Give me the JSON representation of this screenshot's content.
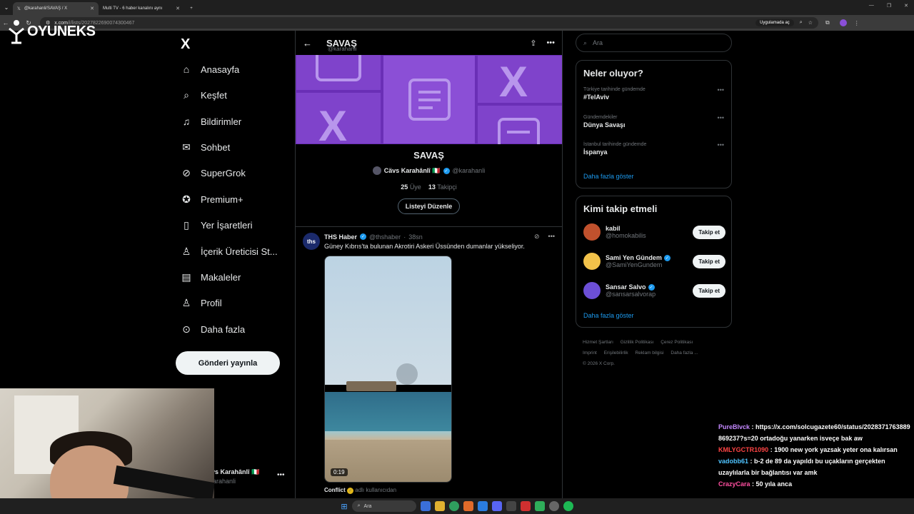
{
  "browser": {
    "tabs": [
      {
        "label": "@karahanli/SAVAŞ / X",
        "active": true
      },
      {
        "label": "Multi TV - 6 haber kanalını aynı",
        "active": false
      }
    ],
    "url_host": "x.com",
    "url_path": "/i/lists/2027822690074300467",
    "open_in_app": "Uygulamada aç"
  },
  "overlay_logo": "OYUNEKS",
  "sidebar": {
    "logo": "X",
    "items": [
      {
        "label": "Anasayfa",
        "icon": "home-icon",
        "glyph": "⌂"
      },
      {
        "label": "Keşfet",
        "icon": "search-icon",
        "glyph": "⌕"
      },
      {
        "label": "Bildirimler",
        "icon": "bell-icon",
        "glyph": "♫"
      },
      {
        "label": "Sohbet",
        "icon": "mail-icon",
        "glyph": "✉"
      },
      {
        "label": "SuperGrok",
        "icon": "grok-icon",
        "glyph": "⊘"
      },
      {
        "label": "Premium+",
        "icon": "premium-icon",
        "glyph": "✪"
      },
      {
        "label": "Yer İşaretleri",
        "icon": "bookmark-icon",
        "glyph": "▯"
      },
      {
        "label": "İçerik Üreticisi St...",
        "icon": "creator-icon",
        "glyph": "♙"
      },
      {
        "label": "Makaleler",
        "icon": "articles-icon",
        "glyph": "▤"
      },
      {
        "label": "Profil",
        "icon": "profile-icon",
        "glyph": "♙"
      },
      {
        "label": "Daha fazla",
        "icon": "more-icon",
        "glyph": "⊙"
      }
    ],
    "post_button": "Gönderi yayınla",
    "account_name": "vs Karahânlî 🇮🇹",
    "account_handle": "arahanli"
  },
  "main": {
    "header_title": "SAVAŞ",
    "header_handle": "@karahanli",
    "list_title": "SAVAŞ",
    "owner_name": "Cävs Karahânlî 🇮🇹",
    "owner_handle": "@karahanli",
    "members_count": "25",
    "members_label": "Üye",
    "followers_count": "13",
    "followers_label": "Takipçi",
    "edit_button": "Listeyi Düzenle",
    "tweet": {
      "avatar_text": "ths",
      "name": "THS Haber",
      "handle": "@thshaber",
      "time": "38sn",
      "text": "Güney Kıbrıs'ta bulunan Akrotiri Askeri Üssünden dumanlar yükseliyor.",
      "video_duration": "0:19",
      "footnote_name": "Conflict",
      "footnote_text": "adlı kullanıcıdan"
    }
  },
  "right": {
    "search_placeholder": "Ara",
    "trends_title": "Neler oluyor?",
    "trends": [
      {
        "context": "Türkiye tarihinde gündemde",
        "name": "#TelAviv"
      },
      {
        "context": "Gündemdekiler",
        "name": "Dünya Savaşı"
      },
      {
        "context": "İstanbul tarihinde gündemde",
        "name": "İspanya"
      }
    ],
    "trends_more": "Daha fazla göster",
    "who_title": "Kimi takip etmeli",
    "who": [
      {
        "name": "kabil",
        "handle": "@homokabilis",
        "verified": false,
        "color": "#c0512d"
      },
      {
        "name": "Sami Yen Gündem",
        "handle": "@SamiYenGundem",
        "verified": true,
        "color": "#f2c24a"
      },
      {
        "name": "Sansar Salvo",
        "handle": "@sansarsalvorap",
        "verified": true,
        "color": "#6c4fd6"
      }
    ],
    "follow_label": "Takip et",
    "who_more": "Daha fazla göster",
    "footer": [
      "Hizmet Şartları",
      "Gizlilik Politikası",
      "Çerez Politikası",
      "Imprint",
      "Erişilebilirlik",
      "Reklam bilgisi",
      "Daha fazla ...",
      "© 2026 X Corp."
    ]
  },
  "chat": [
    {
      "user": "PureBlvck",
      "msg": "https://x.com/solcugazete60/status/2028371763889869237?s=20 ortadoğu yanarken isveçe bak aw"
    },
    {
      "user": "KMLYGCTR1090",
      "msg": "1900 new york yazsak yeter ona kalırsan"
    },
    {
      "user": "vadobb61",
      "msg": "b-2 de 89 da yapıldı bu uçakların gerçekten uzaylılarla bir bağlantısı var amk"
    },
    {
      "user": "CrazyCara",
      "msg": "50 yıla anca"
    }
  ],
  "taskbar": {
    "search": "Ara"
  },
  "colors": {
    "accent": "#1d9bf0",
    "banner": "#8b4fd6",
    "border": "#2f3336",
    "muted": "#71767b"
  }
}
